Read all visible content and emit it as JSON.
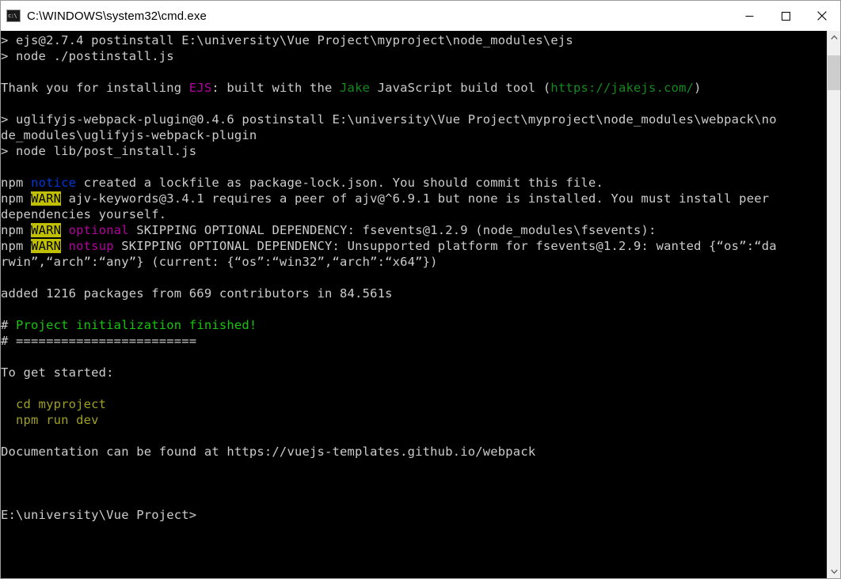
{
  "window": {
    "title": "C:\\WINDOWS\\system32\\cmd.exe",
    "icon": "cmd-icon",
    "controls": {
      "minimize_label": "Minimize",
      "maximize_label": "Maximize",
      "close_label": "Close"
    },
    "colors": {
      "titlebar_bg": "#ffffff",
      "console_bg": "#000000",
      "console_fg": "#cccccc",
      "green": "#16c60c",
      "dark_green": "#128a1c",
      "magenta": "#b4009e",
      "blue": "#0037da",
      "olive": "#a0a021",
      "warn_bg": "#c0c000"
    }
  },
  "scrollbar": {
    "up_arrow": "chevron-up-icon",
    "down_arrow": "chevron-down-icon",
    "thumb_position_pct": 2
  },
  "console": {
    "lines": [
      {
        "segments": [
          {
            "text": "> ejs@2.7.4 postinstall E:\\university\\Vue Project\\myproject\\node_modules\\ejs",
            "color": "white"
          }
        ]
      },
      {
        "segments": [
          {
            "text": "> node ./postinstall.js",
            "color": "white"
          }
        ]
      },
      {
        "segments": [
          {
            "text": "",
            "color": "white"
          }
        ]
      },
      {
        "segments": [
          {
            "text": "Thank you for installing ",
            "color": "white"
          },
          {
            "text": "EJS",
            "color": "magenta"
          },
          {
            "text": ": built with the ",
            "color": "white"
          },
          {
            "text": "Jake",
            "color": "dgreen"
          },
          {
            "text": " JavaScript build tool (",
            "color": "white"
          },
          {
            "text": "https://jakejs.com/",
            "color": "dgreen"
          },
          {
            "text": ")",
            "color": "white"
          }
        ]
      },
      {
        "segments": [
          {
            "text": "",
            "color": "white"
          }
        ]
      },
      {
        "segments": [
          {
            "text": "> uglifyjs-webpack-plugin@0.4.6 postinstall E:\\university\\Vue Project\\myproject\\node_modules\\webpack\\no",
            "color": "white"
          }
        ]
      },
      {
        "segments": [
          {
            "text": "de_modules\\uglifyjs-webpack-plugin",
            "color": "white"
          }
        ]
      },
      {
        "segments": [
          {
            "text": "> node lib/post_install.js",
            "color": "white"
          }
        ]
      },
      {
        "segments": [
          {
            "text": "",
            "color": "white"
          }
        ]
      },
      {
        "segments": [
          {
            "text": "npm ",
            "color": "white"
          },
          {
            "text": "notice",
            "color": "blue"
          },
          {
            "text": " created a lockfile as package-lock.json. You should commit this file.",
            "color": "white"
          }
        ]
      },
      {
        "segments": [
          {
            "text": "npm ",
            "color": "white"
          },
          {
            "text": "WARN",
            "color": "warn"
          },
          {
            "text": " ajv-keywords@3.4.1 requires a peer of ajv@^6.9.1 but none is installed. You must install peer",
            "color": "white"
          }
        ]
      },
      {
        "segments": [
          {
            "text": "dependencies yourself.",
            "color": "white"
          }
        ]
      },
      {
        "segments": [
          {
            "text": "npm ",
            "color": "white"
          },
          {
            "text": "WARN",
            "color": "warn"
          },
          {
            "text": " ",
            "color": "white"
          },
          {
            "text": "optional",
            "color": "magenta"
          },
          {
            "text": " SKIPPING OPTIONAL DEPENDENCY: fsevents@1.2.9 (node_modules\\fsevents):",
            "color": "white"
          }
        ]
      },
      {
        "segments": [
          {
            "text": "npm ",
            "color": "white"
          },
          {
            "text": "WARN",
            "color": "warn"
          },
          {
            "text": " ",
            "color": "white"
          },
          {
            "text": "notsup",
            "color": "magenta"
          },
          {
            "text": " SKIPPING OPTIONAL DEPENDENCY: Unsupported platform for fsevents@1.2.9: wanted {“os”:“da",
            "color": "white"
          }
        ]
      },
      {
        "segments": [
          {
            "text": "rwin”,“arch”:“any”} (current: {“os”:“win32”,“arch”:“x64”})",
            "color": "white"
          }
        ]
      },
      {
        "segments": [
          {
            "text": "",
            "color": "white"
          }
        ]
      },
      {
        "segments": [
          {
            "text": "added 1216 packages from 669 contributors in 84.561s",
            "color": "white"
          }
        ]
      },
      {
        "segments": [
          {
            "text": "",
            "color": "white"
          }
        ]
      },
      {
        "segments": [
          {
            "text": "# ",
            "color": "white"
          },
          {
            "text": "Project initialization finished!",
            "color": "green"
          }
        ]
      },
      {
        "segments": [
          {
            "text": "# ========================",
            "color": "white"
          }
        ]
      },
      {
        "segments": [
          {
            "text": "",
            "color": "white"
          }
        ]
      },
      {
        "segments": [
          {
            "text": "To get started:",
            "color": "white"
          }
        ]
      },
      {
        "segments": [
          {
            "text": "",
            "color": "white"
          }
        ]
      },
      {
        "segments": [
          {
            "text": "  cd myproject",
            "color": "olive"
          }
        ]
      },
      {
        "segments": [
          {
            "text": "  npm run dev",
            "color": "olive"
          }
        ]
      },
      {
        "segments": [
          {
            "text": "",
            "color": "white"
          }
        ]
      },
      {
        "segments": [
          {
            "text": "Documentation can be found at https://vuejs-templates.github.io/webpack",
            "color": "white"
          }
        ]
      },
      {
        "segments": [
          {
            "text": "",
            "color": "white"
          }
        ]
      },
      {
        "segments": [
          {
            "text": "",
            "color": "white"
          }
        ]
      },
      {
        "segments": [
          {
            "text": "",
            "color": "white"
          }
        ]
      },
      {
        "segments": [
          {
            "text": "E:\\university\\Vue Project>",
            "color": "white"
          }
        ]
      }
    ]
  }
}
